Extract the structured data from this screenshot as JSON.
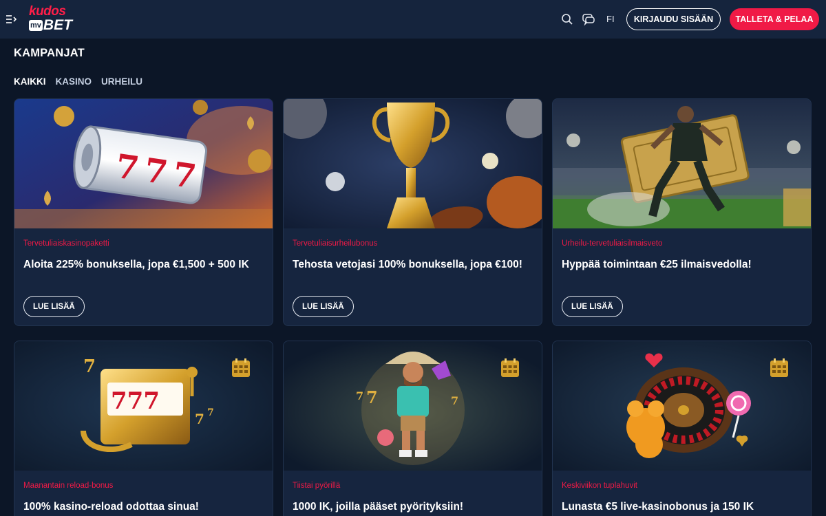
{
  "header": {
    "logo_top": "kudos",
    "logo_badge": "mv",
    "logo_bottom": "BET",
    "language": "FI",
    "login_label": "KIRJAUDU SISÄÄN",
    "deposit_label": "TALLETA & PELAA",
    "icons": [
      "menu-icon",
      "search-icon",
      "chat-icon"
    ]
  },
  "page": {
    "title": "KAMPANJAT",
    "filters": [
      {
        "label": "KAIKKI",
        "active": true
      },
      {
        "label": "KASINO",
        "active": false
      },
      {
        "label": "URHEILU",
        "active": false
      }
    ]
  },
  "promotions": [
    {
      "category": "Tervetuliaiskasinopaketti",
      "title": "Aloita 225% bonuksella, jopa €1,500 + 500 IK",
      "button": "LUE LISÄÄ",
      "image": "slot-reel-777"
    },
    {
      "category": "Tervetuliaisurheilubonus",
      "title": "Tehosta vetojasi 100% bonuksella, jopa €100!",
      "button": "LUE LISÄÄ",
      "image": "golden-trophy-balls"
    },
    {
      "category": "Urheilu-tervetuliaisilmaisveto",
      "title": "Hyppää toimintaan €25 ilmaisvedolla!",
      "button": "LUE LISÄÄ",
      "image": "footballer-golden-ticket"
    },
    {
      "category": "Maanantain reload-bonus",
      "title": "100% kasino-reload odottaa sinua!",
      "image": "golden-slot-machine"
    },
    {
      "category": "Tiistai pyörillä",
      "title": "1000 IK, joilla pääset pyörityksiin!",
      "image": "cowboy-character"
    },
    {
      "category": "Keskiviikon tuplahuvit",
      "title": "Lunasta €5 live-kasinobonus ja 150 IK",
      "image": "roulette-wheel-candy"
    }
  ],
  "colors": {
    "background": "#0c1627",
    "header": "#15243d",
    "card": "#16253f",
    "accent": "#f01a46"
  }
}
